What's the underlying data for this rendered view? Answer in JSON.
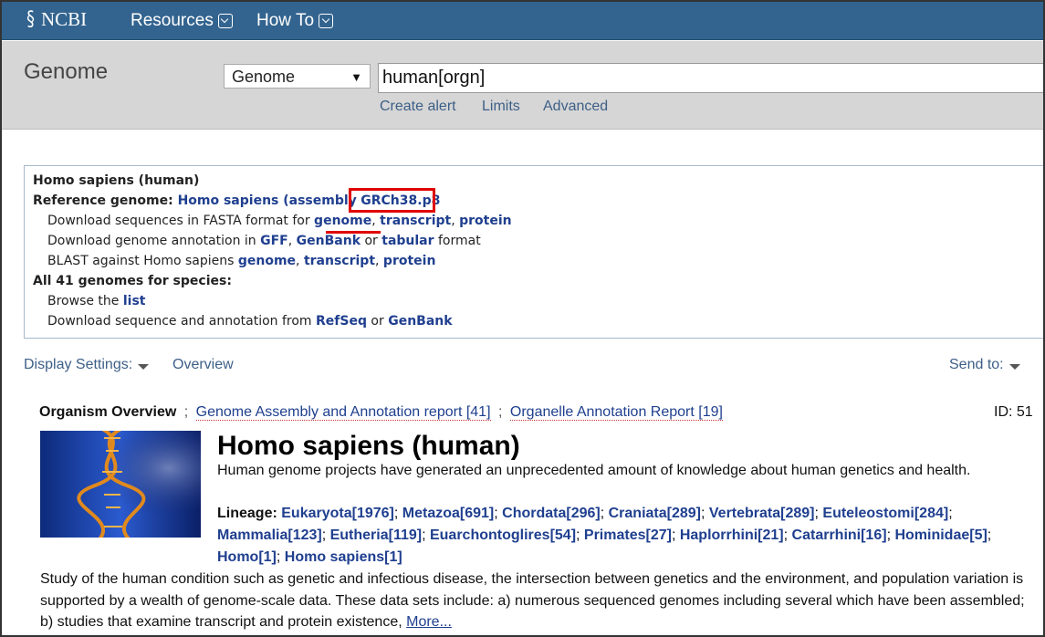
{
  "topbar": {
    "logo_text": "NCBI",
    "resources_label": "Resources",
    "howto_label": "How To"
  },
  "search": {
    "db_title": "Genome",
    "db_select_value": "Genome",
    "query_value": "human[orgn]",
    "links": [
      "Create alert",
      "Limits",
      "Advanced"
    ]
  },
  "refbox": {
    "species": "Homo sapiens (human)",
    "ref_prefix": "Reference genome: ",
    "ref_link": "Homo sapiens (assembly",
    "assembly": "GRCh38.p8",
    "fasta_prefix": "Download sequences in FASTA format for ",
    "fasta_links": [
      "genome",
      "transcript",
      "protein"
    ],
    "annot_prefix": "Download genome annotation in ",
    "annot_links": [
      "GFF",
      "GenBank",
      "tabular"
    ],
    "annot_suffix": " format",
    "or_word": " or ",
    "blast_prefix": "BLAST against Homo sapiens ",
    "all_genomes": "All 41 genomes for species:",
    "browse_prefix": "Browse the ",
    "browse_link": "list",
    "download_prefix": "Download sequence and annotation from ",
    "download_links": [
      "RefSeq",
      "GenBank"
    ],
    "comma": ", "
  },
  "display": {
    "settings_label": "Display Settings:",
    "overview_label": "Overview",
    "sendto_label": "Send to:"
  },
  "overview": {
    "title": "Organism Overview",
    "sep": ";",
    "report1": "Genome Assembly and Annotation report [41]",
    "report2": "Organelle Annotation Report [19]",
    "id_text": "ID: 51"
  },
  "organism": {
    "name": "Homo sapiens (human)",
    "description": "Human genome projects have generated an unprecedented amount of knowledge about human genetics and health.",
    "lineage_label": "Lineage:",
    "lineage": [
      "Eukaryota[1976]",
      "Metazoa[691]",
      "Chordata[296]",
      "Craniata[289]",
      "Vertebrata[289]",
      "Euteleostomi[284]",
      "Mammalia[123]",
      "Eutheria[119]",
      "Euarchontoglires[54]",
      "Primates[27]",
      "Haplorrhini[21]",
      "Catarrhini[16]",
      "Hominidae[5]",
      "Homo[1]",
      "Homo sapiens[1]"
    ],
    "study_text": "Study of the human condition such as genetic and infectious disease, the intersection between genetics and the environment, and population variation is supported by a wealth of genome-scale data. These data sets include: a) numerous sequenced genomes including several which have been assembled; b) studies that examine transcript and protein existence, ",
    "more_link": "More..."
  },
  "colors": {
    "topbar": "#33648f",
    "link": "#1f3f8f",
    "highlight": "#e00000"
  }
}
